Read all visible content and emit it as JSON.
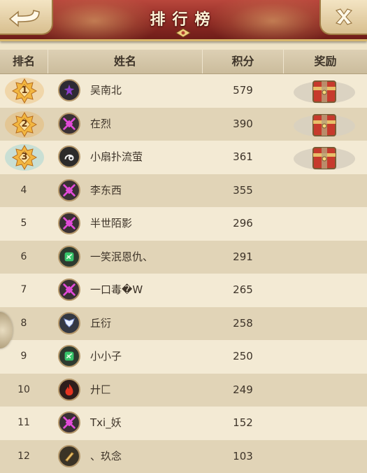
{
  "header": {
    "title": "排行榜",
    "back_icon": "back-arrow-icon",
    "close_icon": "close-x-icon"
  },
  "columns": [
    "排名",
    "姓名",
    "积分",
    "奖励"
  ],
  "colors": {
    "banner_red": "#8e2a24",
    "row_light": "#f3ead4",
    "row_dark": "#e1d4b7",
    "gold": "#e8a23a",
    "text": "#3e3429"
  },
  "rows": [
    {
      "rank": "1",
      "name": "吴南北",
      "score": "579",
      "avatar": "purple-emblem-icon",
      "reward": "treasure-chest-icon"
    },
    {
      "rank": "2",
      "name": "在烈",
      "score": "390",
      "avatar": "pink-swords-icon",
      "reward": "treasure-chest-icon"
    },
    {
      "rank": "3",
      "name": "小扇扑流萤",
      "score": "361",
      "avatar": "white-swirl-icon",
      "reward": "treasure-chest-icon"
    },
    {
      "rank": "4",
      "name": "李东西",
      "score": "355",
      "avatar": "pink-swords-icon"
    },
    {
      "rank": "5",
      "name": "半世陌影",
      "score": "296",
      "avatar": "pink-swords-icon"
    },
    {
      "rank": "6",
      "name": "一笑泯恩仇、",
      "score": "291",
      "avatar": "green-leaf-icon"
    },
    {
      "rank": "7",
      "name": "一口毒�W",
      "score": "265",
      "avatar": "pink-swords-icon"
    },
    {
      "rank": "8",
      "name": "丘衍",
      "score": "258",
      "avatar": "white-wings-icon"
    },
    {
      "rank": "9",
      "name": "小小子",
      "score": "250",
      "avatar": "green-leaf-icon"
    },
    {
      "rank": "10",
      "name": "廾匚",
      "score": "249",
      "avatar": "red-flame-icon"
    },
    {
      "rank": "11",
      "name": "Txi_妖",
      "score": "152",
      "avatar": "pink-swords-icon"
    },
    {
      "rank": "12",
      "name": "、玖念",
      "score": "103",
      "avatar": "gold-scroll-icon"
    }
  ]
}
